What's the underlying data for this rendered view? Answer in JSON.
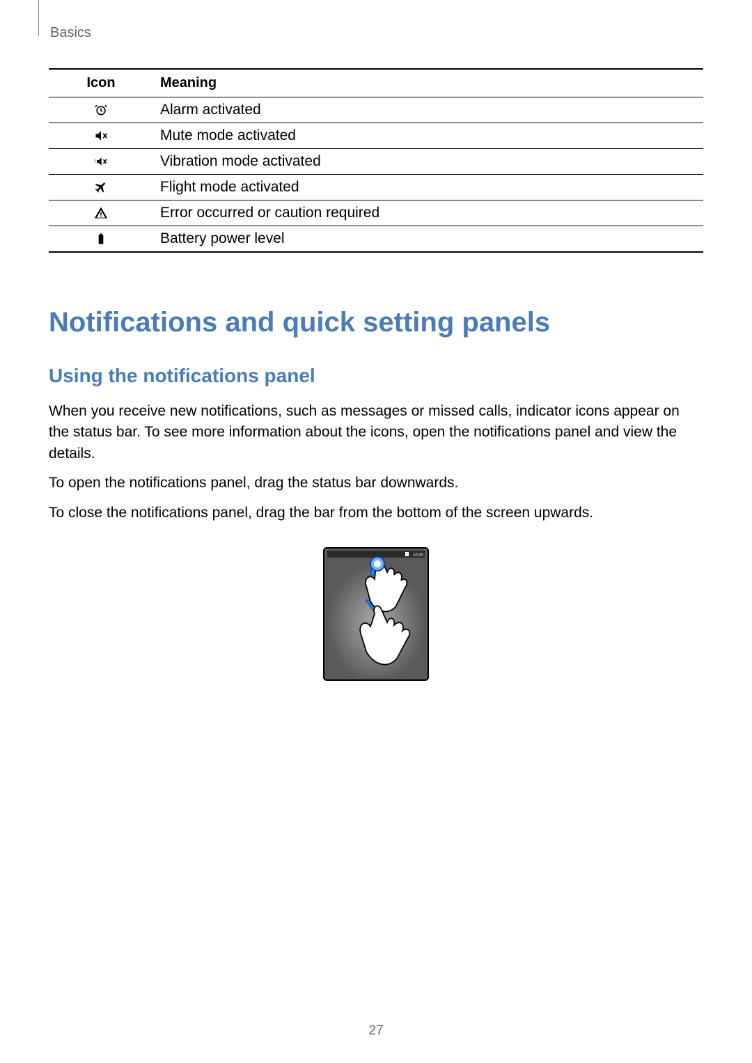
{
  "breadcrumb": "Basics",
  "table": {
    "headers": {
      "icon": "Icon",
      "meaning": "Meaning"
    },
    "rows": [
      {
        "icon": "alarm",
        "meaning": "Alarm activated"
      },
      {
        "icon": "mute",
        "meaning": "Mute mode activated"
      },
      {
        "icon": "vibration",
        "meaning": "Vibration mode activated"
      },
      {
        "icon": "flight",
        "meaning": "Flight mode activated"
      },
      {
        "icon": "error",
        "meaning": "Error occurred or caution required"
      },
      {
        "icon": "battery",
        "meaning": "Battery power level"
      }
    ]
  },
  "heading1": "Notifications and quick setting panels",
  "heading2": "Using the notifications panel",
  "para1": "When you receive new notifications, such as messages or missed calls, indicator icons appear on the status bar. To see more information about the icons, open the notifications panel and view the details.",
  "para2": "To open the notifications panel, drag the status bar downwards.",
  "para3": "To close the notifications panel, drag the bar from the bottom of the screen upwards.",
  "illustration_time": "10:00",
  "page_number": "27"
}
